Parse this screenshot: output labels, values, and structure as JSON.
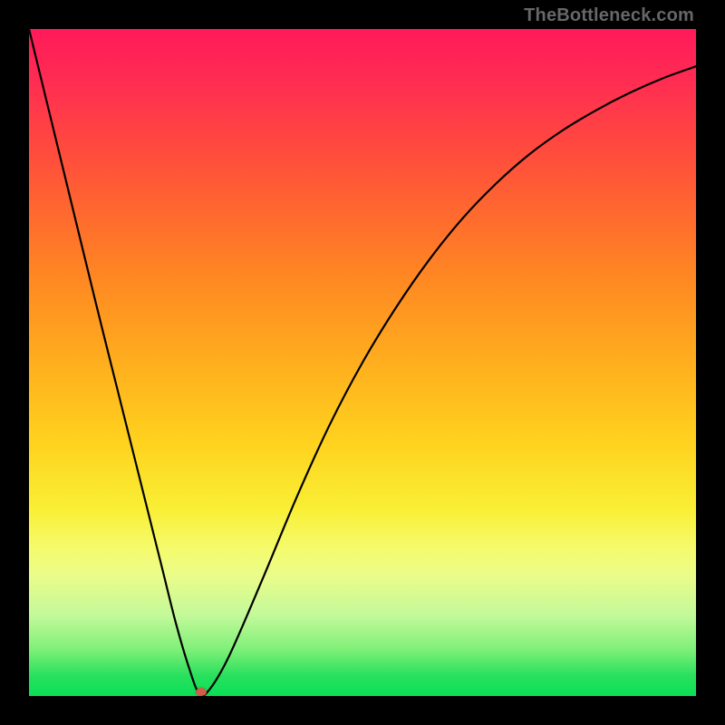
{
  "watermark": "TheBottleneck.com",
  "chart_data": {
    "type": "line",
    "title": "",
    "xlabel": "",
    "ylabel": "",
    "xlim": [
      0,
      100
    ],
    "ylim": [
      0,
      100
    ],
    "grid": false,
    "series": [
      {
        "name": "curve",
        "x": [
          0,
          5,
          10,
          15,
          18,
          20,
          22,
          24,
          25.5,
          27,
          30,
          35,
          40,
          45,
          50,
          55,
          60,
          65,
          70,
          75,
          80,
          85,
          90,
          95,
          100
        ],
        "values": [
          100,
          79.5,
          59,
          39,
          27,
          19,
          11,
          4.2,
          0.4,
          0.9,
          6,
          17.5,
          29.5,
          40.5,
          50,
          58.2,
          65.4,
          71.6,
          76.8,
          81.2,
          84.8,
          87.8,
          90.4,
          92.6,
          94.4
        ]
      }
    ],
    "marker": {
      "x": 25.8,
      "y": 0.6,
      "color": "#d45c4a"
    },
    "background_gradient": {
      "from": "#ff1a5a",
      "to": "#0adf55",
      "direction": "top-to-bottom"
    }
  }
}
